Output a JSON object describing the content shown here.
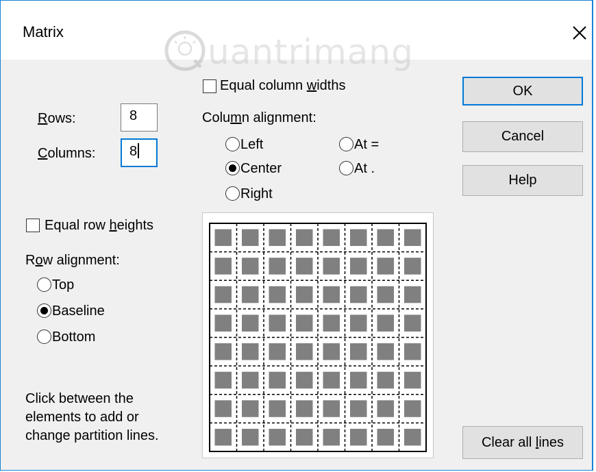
{
  "title": "Matrix",
  "watermark": "uantrimang",
  "rows": {
    "label_first": "R",
    "label_rest": "ows:",
    "value": "8"
  },
  "columns": {
    "label_first": "C",
    "label_rest": "olumns:",
    "value": "8"
  },
  "equal_column_widths": {
    "pre": "Equal column ",
    "u": "w",
    "post": "idths",
    "checked": false
  },
  "column_alignment": {
    "pre": "Colu",
    "u": "m",
    "post": "n alignment:",
    "options": [
      {
        "label": "Left",
        "selected": false
      },
      {
        "label": "At =",
        "selected": false
      },
      {
        "label": "Center",
        "selected": true
      },
      {
        "label": "At .",
        "selected": false
      },
      {
        "label": "Right",
        "selected": false
      }
    ]
  },
  "equal_row_heights": {
    "pre": "Equal row ",
    "u": "h",
    "post": "eights",
    "checked": false
  },
  "row_alignment": {
    "pre": "R",
    "u": "o",
    "post": "w alignment:",
    "options": [
      {
        "label": "Top",
        "selected": false
      },
      {
        "label": "Baseline",
        "selected": true
      },
      {
        "label": "Bottom",
        "selected": false
      }
    ]
  },
  "help_text": [
    "Click between the",
    "elements to add or",
    "change partition lines."
  ],
  "buttons": {
    "ok": "OK",
    "cancel": "Cancel",
    "help": "Help",
    "clear_pre": "Clear all ",
    "clear_u": "l",
    "clear_post": "ines"
  },
  "matrix_preview": {
    "rows": 8,
    "columns": 8
  },
  "colors": {
    "accent": "#0078d7",
    "dialog_bg": "#f0f0f0",
    "cell": "#808080"
  }
}
